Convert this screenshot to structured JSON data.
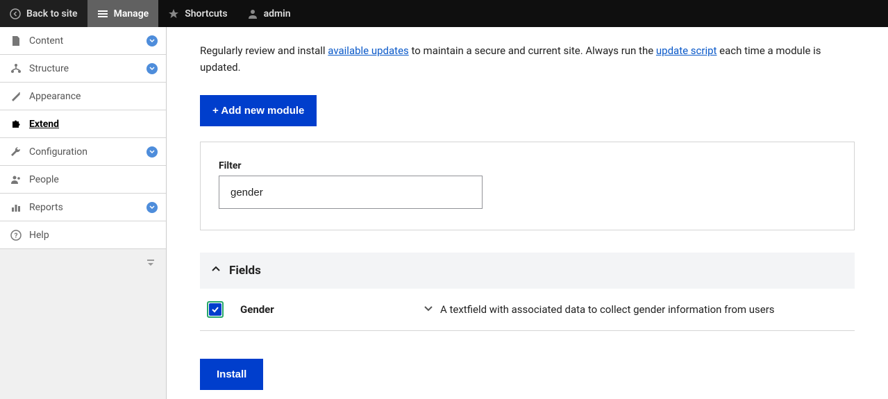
{
  "toolbar": {
    "back": "Back to site",
    "manage": "Manage",
    "shortcuts": "Shortcuts",
    "user": "admin"
  },
  "sidebar": {
    "content": "Content",
    "structure": "Structure",
    "appearance": "Appearance",
    "extend": "Extend",
    "configuration": "Configuration",
    "people": "People",
    "reports": "Reports",
    "help": "Help"
  },
  "main": {
    "intro_line_prefix": "Regularly review and install ",
    "intro_link1": "available updates",
    "intro_line_mid": " to maintain a secure and current site. Always run the ",
    "intro_link2": "update script",
    "intro_line_suffix": " each time a module is updated.",
    "add_module_btn": "+ Add new module",
    "filter_label": "Filter",
    "filter_value": "gender",
    "section_title": "Fields",
    "module_name": "Gender",
    "module_desc": "A textfield with associated data to collect gender information from users",
    "install_btn": "Install"
  }
}
